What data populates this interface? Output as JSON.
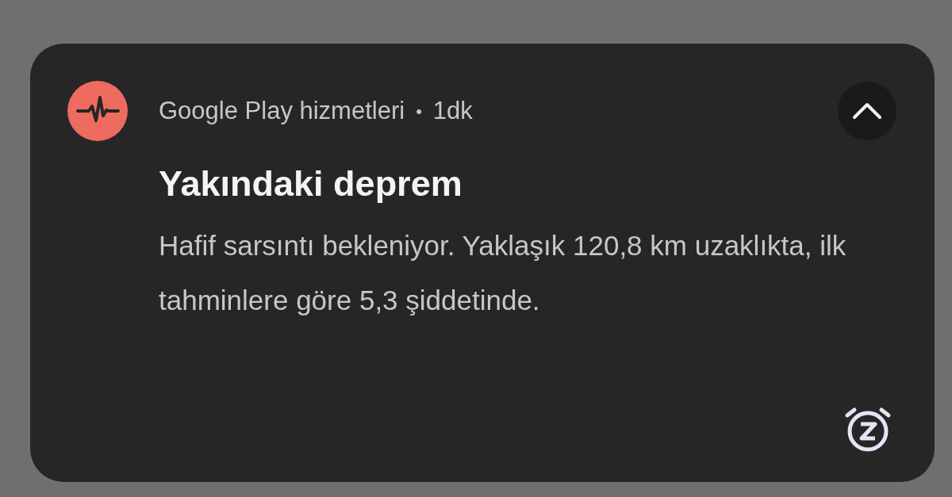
{
  "notification": {
    "app_name": "Google Play hizmetleri",
    "separator": "•",
    "time": "1dk",
    "expanded": true,
    "title": "Yakındaki deprem",
    "body": "Hafif sarsıntı bekleniyor. Yaklaşık 120,8 km uzaklıkta, ilk tahminlere göre 5,3 şiddetinde."
  }
}
